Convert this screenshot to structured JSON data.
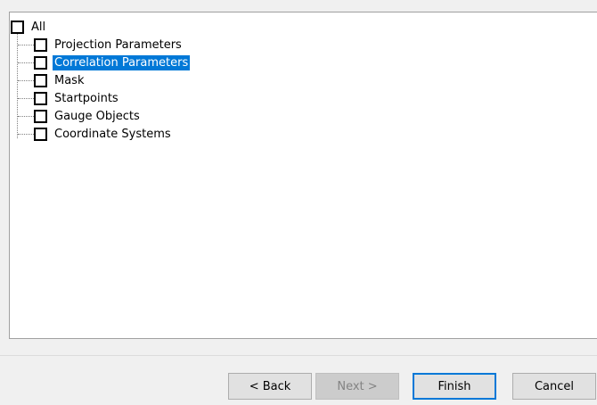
{
  "tree": {
    "root": {
      "label": "All",
      "checked": false
    },
    "items": [
      {
        "label": "Projection Parameters",
        "checked": false,
        "selected": false
      },
      {
        "label": "Correlation Parameters",
        "checked": false,
        "selected": true
      },
      {
        "label": "Mask",
        "checked": false,
        "selected": false
      },
      {
        "label": "Startpoints",
        "checked": false,
        "selected": false
      },
      {
        "label": "Gauge Objects",
        "checked": false,
        "selected": false
      },
      {
        "label": "Coordinate Systems",
        "checked": false,
        "selected": false
      }
    ]
  },
  "buttons": {
    "back": "< Back",
    "next": "Next >",
    "finish": "Finish",
    "cancel": "Cancel"
  },
  "colors": {
    "selection": "#0078d7",
    "default_button_border": "#0078d7"
  }
}
